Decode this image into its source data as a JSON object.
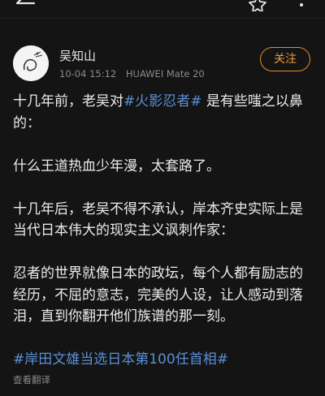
{
  "header": {
    "back_icon": "back-arrow-icon",
    "star_icon": "star-outline-icon",
    "more_icon": "more-vertical-icon"
  },
  "post": {
    "author": "吴知山",
    "time": "10-04 15:12",
    "device": "HUAWEI Mate 20",
    "follow_label": "关注",
    "paragraphs": {
      "p1_pre": "十几年前，老吴对",
      "p1_tag": "#火影忍者#",
      "p1_post": " 是有些嗤之以鼻的：",
      "p2": "什么王道热血少年漫，太套路了。",
      "p3": "十几年后，老吴不得不承认，岸本齐史实际上是当代日本伟大的现实主义讽刺作家：",
      "p4": "忍者的世界就像日本的政坛，每个人都有励志的经历，不屈的意志，完美的人设，让人感动到落泪，直到你翻开他们族谱的那一刻。",
      "p5_tag": "#岸田文雄当选日本第100任首相#"
    },
    "translate_label": "查看翻译"
  },
  "colors": {
    "background": "#141414",
    "hashtag": "#5b8fd6",
    "follow_accent": "#ef9a3a"
  }
}
